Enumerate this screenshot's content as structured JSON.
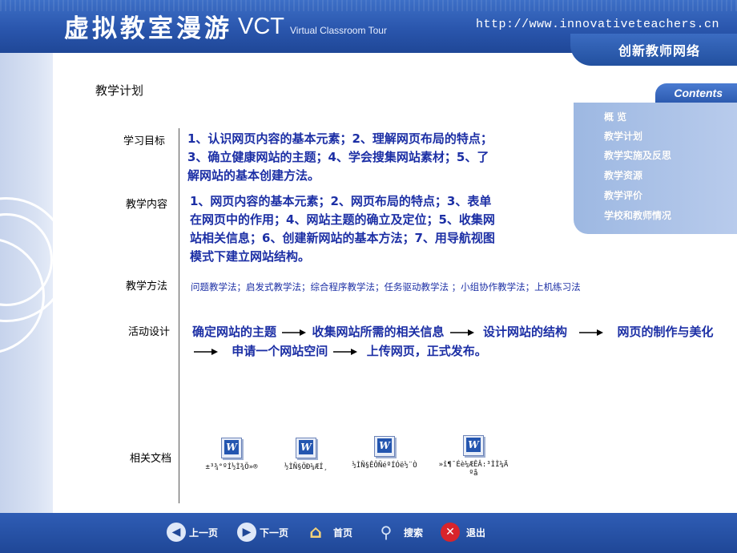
{
  "header": {
    "title_cn": "虚拟教室漫游",
    "title_abbr": "VCT",
    "title_en": "Virtual Classroom Tour",
    "url": "http://www.innovativeteachers.cn",
    "brand": "创新教师网络"
  },
  "page_title": "教学计划",
  "sections": {
    "goals": {
      "label": "学习目标",
      "lines": [
        "1、认识网页内容的基本元素；2、理解网页布局的特点；",
        "3、确立健康网站的主题；4、学会搜集网站素材；5、了",
        "解网站的基本创建方法。"
      ]
    },
    "content": {
      "label": "教学内容",
      "lines": [
        "1、网页内容的基本元素；2、网页布局的特点；3、表单",
        "在网页中的作用；4、网站主题的确立及定位；5、收集网",
        "站相关信息；6、创建新网站的基本方法；7、用导航视图",
        "模式下建立网站结构。"
      ]
    },
    "methods": {
      "label": "教学方法",
      "text": "问题教学法；启发式教学法；综合程序教学法；任务驱动教学法 ；小组协作教学法；上机练习法"
    },
    "activities": {
      "label": "活动设计",
      "steps": [
        "确定网站的主题",
        "收集网站所需的相关信息",
        "设计网站的结构",
        "网页的制作与美化",
        "申请一个网站空间",
        "上传网页，正式发布。"
      ]
    },
    "docs": {
      "label": "相关文档",
      "files": [
        {
          "name": "±³¾°ºÍ½Ì¾Ö»®"
        },
        {
          "name": "½ÌÑ§ÖÐ¼ÆÍ¸"
        },
        {
          "name": "½ÌÑ§ÊÔÑéºÍÓë½¨Ò"
        },
        {
          "name": "»î¶¯Éè¼ÆÊÂ:³ÌÌ¼Ä ºå"
        }
      ]
    }
  },
  "contents": {
    "heading": "Contents",
    "items": [
      "概  览",
      "教学计划",
      "教学实施及反思",
      "教学资源",
      "教学评价",
      "学校和教师情况"
    ]
  },
  "nav": {
    "prev": "上一页",
    "next": "下一页",
    "home": "首页",
    "search": "搜索",
    "exit": "退出"
  },
  "colors": {
    "header_blue": "#2a56ad",
    "text_blue": "#1c2fa5",
    "menu_panel": "#b8cbec"
  }
}
